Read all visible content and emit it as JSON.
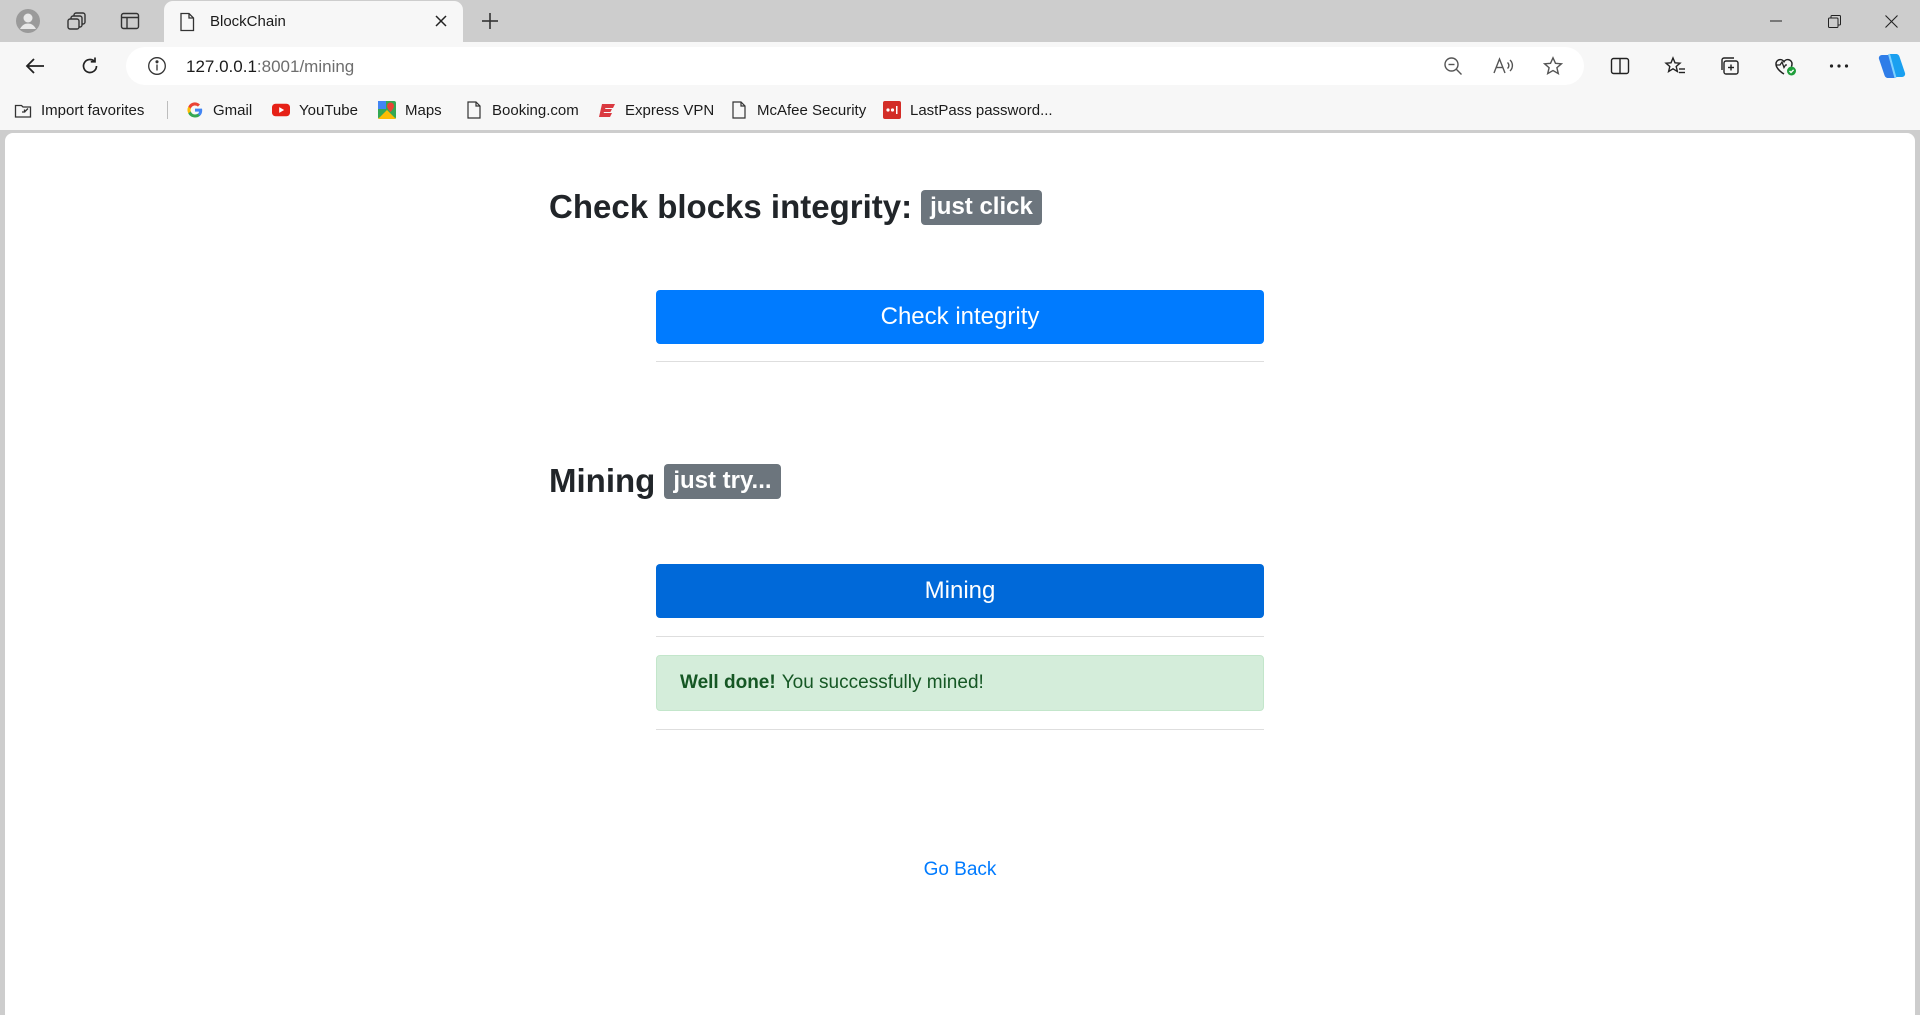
{
  "browser": {
    "tab_title": "BlockChain",
    "url_host": "127.0.0.1",
    "url_path": ":8001/mining"
  },
  "favorites": [
    {
      "label": "Import favorites",
      "icon": "import-icon"
    },
    {
      "label": "Gmail",
      "icon": "google-icon"
    },
    {
      "label": "YouTube",
      "icon": "youtube-icon"
    },
    {
      "label": "Maps",
      "icon": "maps-icon"
    },
    {
      "label": "Booking.com",
      "icon": "page-icon"
    },
    {
      "label": "Express VPN",
      "icon": "expressvpn-icon"
    },
    {
      "label": "McAfee Security",
      "icon": "page-icon"
    },
    {
      "label": "LastPass password...",
      "icon": "lastpass-icon"
    }
  ],
  "page": {
    "integrity_heading": "Check blocks integrity:",
    "integrity_badge": "just click",
    "check_button": "Check integrity",
    "mining_heading": "Mining",
    "mining_badge": "just try...",
    "mining_button": "Mining",
    "alert_strong": "Well done!",
    "alert_text": "You successfully mined!",
    "go_back": "Go Back"
  },
  "colors": {
    "primary": "#007bff",
    "primary_active": "#0069d9",
    "badge": "#6c757d",
    "success_bg": "#d4edda",
    "success_text": "#155724"
  }
}
